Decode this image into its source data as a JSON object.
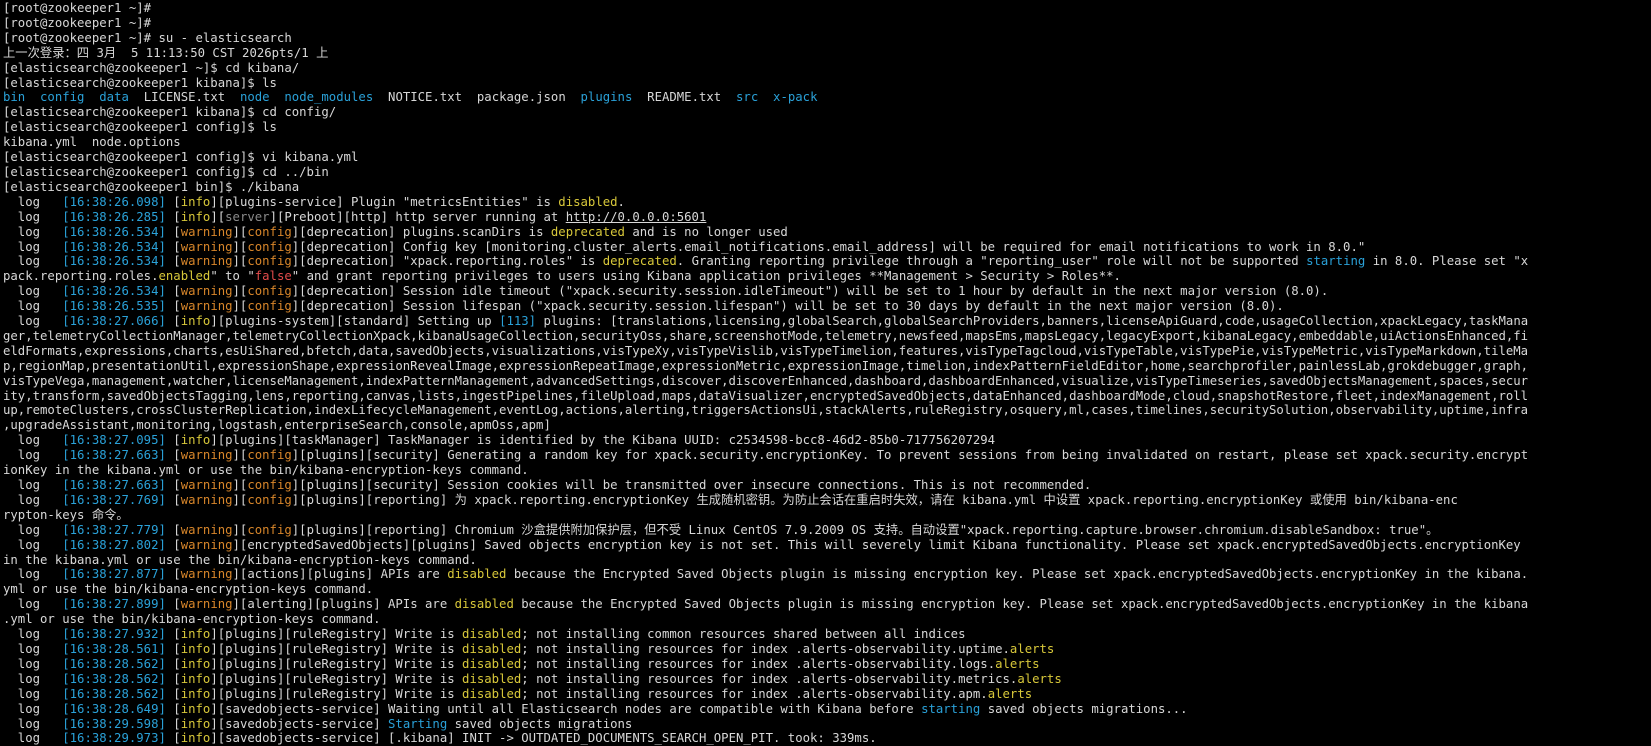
{
  "colors": {
    "background": "#000000",
    "text": "#d8d8d8",
    "blue": "#2aa1d8",
    "yellow": "#d8c83a",
    "orange": "#d8862a",
    "gray": "#8a8a8a",
    "red": "#e34b4b"
  },
  "lines": [
    [
      [
        "[root@zookeeper1 ~]#",
        ""
      ]
    ],
    [
      [
        "[root@zookeeper1 ~]#",
        ""
      ]
    ],
    [
      [
        "[root@zookeeper1 ~]# su - elasticsearch",
        ""
      ]
    ],
    [
      [
        "上一次登录：四 3月  5 11:13:50 CST 2026pts/1 上",
        ""
      ]
    ],
    [
      [
        "[elasticsearch@zookeeper1 ~]$ cd kibana/",
        ""
      ]
    ],
    [
      [
        "[elasticsearch@zookeeper1 kibana]$ ls",
        ""
      ]
    ],
    [
      [
        "bin",
        "c-blue"
      ],
      [
        "  ",
        ""
      ],
      [
        "config",
        "c-blue"
      ],
      [
        "  ",
        ""
      ],
      [
        "data",
        "c-blue"
      ],
      [
        "  LICENSE.txt  ",
        ""
      ],
      [
        "node",
        "c-blue"
      ],
      [
        "  ",
        ""
      ],
      [
        "node_modules",
        "c-blue"
      ],
      [
        "  NOTICE.txt  package.json  ",
        ""
      ],
      [
        "plugins",
        "c-blue"
      ],
      [
        "  README.txt  ",
        ""
      ],
      [
        "src",
        "c-blue"
      ],
      [
        "  ",
        ""
      ],
      [
        "x-pack",
        "c-blue"
      ]
    ],
    [
      [
        "[elasticsearch@zookeeper1 kibana]$ cd config/",
        ""
      ]
    ],
    [
      [
        "[elasticsearch@zookeeper1 config]$ ls",
        ""
      ]
    ],
    [
      [
        "kibana.yml  node.options",
        ""
      ]
    ],
    [
      [
        "[elasticsearch@zookeeper1 config]$ vi kibana.yml",
        ""
      ]
    ],
    [
      [
        "[elasticsearch@zookeeper1 config]$ cd ../bin",
        ""
      ]
    ],
    [
      [
        "[elasticsearch@zookeeper1 bin]$ ./kibana",
        ""
      ]
    ],
    [
      [
        "  log   ",
        ""
      ],
      [
        "[16:38:26.098]",
        "c-blue"
      ],
      [
        " [",
        ""
      ],
      [
        "info",
        "c-yellow"
      ],
      [
        "][plugins-service] Plugin \"metricsEntities\" is ",
        ""
      ],
      [
        "disabled",
        "c-yellow"
      ],
      [
        ".",
        ""
      ]
    ],
    [
      [
        "  log   ",
        ""
      ],
      [
        "[16:38:26.285]",
        "c-blue"
      ],
      [
        " [",
        ""
      ],
      [
        "info",
        "c-yellow"
      ],
      [
        "][",
        ""
      ],
      [
        "server",
        "c-gray"
      ],
      [
        "][Preboot][http] http server running at ",
        ""
      ],
      [
        "http://0.0.0.0:5601",
        "u"
      ]
    ],
    [
      [
        "  log   ",
        ""
      ],
      [
        "[16:38:26.534]",
        "c-blue"
      ],
      [
        " [",
        ""
      ],
      [
        "warning",
        "c-orange"
      ],
      [
        "][",
        ""
      ],
      [
        "config",
        "c-orange"
      ],
      [
        "][deprecation] plugins.scanDirs is ",
        ""
      ],
      [
        "deprecated",
        "c-yellow"
      ],
      [
        " and is no longer used",
        ""
      ]
    ],
    [
      [
        "  log   ",
        ""
      ],
      [
        "[16:38:26.534]",
        "c-blue"
      ],
      [
        " [",
        ""
      ],
      [
        "warning",
        "c-orange"
      ],
      [
        "][",
        ""
      ],
      [
        "config",
        "c-orange"
      ],
      [
        "][deprecation] Config key [monitoring.cluster_alerts.email_notifications.email_address] will be required for email notifications to work in 8.0.\"",
        ""
      ]
    ],
    [
      [
        "  log   ",
        ""
      ],
      [
        "[16:38:26.534]",
        "c-blue"
      ],
      [
        " [",
        ""
      ],
      [
        "warning",
        "c-orange"
      ],
      [
        "][",
        ""
      ],
      [
        "config",
        "c-orange"
      ],
      [
        "][deprecation] \"xpack.reporting.roles\" is ",
        ""
      ],
      [
        "deprecated",
        "c-yellow"
      ],
      [
        ". Granting reporting privilege through a \"reporting_user\" role will not be supported ",
        ""
      ],
      [
        "starting",
        "c-blue"
      ],
      [
        " in 8.0. Please set \"x",
        ""
      ]
    ],
    [
      [
        "pack.reporting.roles.",
        ""
      ],
      [
        "enabled",
        "c-yellow"
      ],
      [
        "\" to \"",
        ""
      ],
      [
        "false",
        "c-red"
      ],
      [
        "\" and grant reporting privileges to users using Kibana application privileges **Management > Security > Roles**.",
        ""
      ]
    ],
    [
      [
        "  log   ",
        ""
      ],
      [
        "[16:38:26.534]",
        "c-blue"
      ],
      [
        " [",
        ""
      ],
      [
        "warning",
        "c-orange"
      ],
      [
        "][",
        ""
      ],
      [
        "config",
        "c-orange"
      ],
      [
        "][deprecation] Session idle timeout (\"xpack.security.session.idleTimeout\") will be set to 1 hour by default in the next major version (8.0).",
        ""
      ]
    ],
    [
      [
        "  log   ",
        ""
      ],
      [
        "[16:38:26.535]",
        "c-blue"
      ],
      [
        " [",
        ""
      ],
      [
        "warning",
        "c-orange"
      ],
      [
        "][",
        ""
      ],
      [
        "config",
        "c-orange"
      ],
      [
        "][deprecation] Session lifespan (\"xpack.security.session.lifespan\") will be set to 30 days by default in the next major version (8.0).",
        ""
      ]
    ],
    [
      [
        "  log   ",
        ""
      ],
      [
        "[16:38:27.066]",
        "c-blue"
      ],
      [
        " [",
        ""
      ],
      [
        "info",
        "c-yellow"
      ],
      [
        "][plugins-system][standard] Setting up ",
        ""
      ],
      [
        "[113]",
        "c-blue"
      ],
      [
        " plugins: [translations,licensing,globalSearch,globalSearchProviders,banners,licenseApiGuard,code,usageCollection,xpackLegacy,taskMana",
        ""
      ]
    ],
    [
      [
        "ger,telemetryCollectionManager,telemetryCollectionXpack,kibanaUsageCollection,securityOss,share,screenshotMode,telemetry,newsfeed,mapsEms,mapsLegacy,legacyExport,kibanaLegacy,embeddable,uiActionsEnhanced,fi",
        ""
      ]
    ],
    [
      [
        "eldFormats,expressions,charts,esUiShared,bfetch,data,savedObjects,visualizations,visTypeXy,visTypeVislib,visTypeTimelion,features,visTypeTagcloud,visTypeTable,visTypePie,visTypeMetric,visTypeMarkdown,tileMa",
        ""
      ]
    ],
    [
      [
        "p,regionMap,presentationUtil,expressionShape,expressionRevealImage,expressionRepeatImage,expressionMetric,expressionImage,timelion,indexPatternFieldEditor,home,searchprofiler,painlessLab,grokdebugger,graph,",
        ""
      ]
    ],
    [
      [
        "visTypeVega,management,watcher,licenseManagement,indexPatternManagement,advancedSettings,discover,discoverEnhanced,dashboard,dashboardEnhanced,visualize,visTypeTimeseries,savedObjectsManagement,spaces,secur",
        ""
      ]
    ],
    [
      [
        "ity,transform,savedObjectsTagging,lens,reporting,canvas,lists,ingestPipelines,fileUpload,maps,dataVisualizer,encryptedSavedObjects,dataEnhanced,dashboardMode,cloud,snapshotRestore,fleet,indexManagement,roll",
        ""
      ]
    ],
    [
      [
        "up,remoteClusters,crossClusterReplication,indexLifecycleManagement,eventLog,actions,alerting,triggersActionsUi,stackAlerts,ruleRegistry,osquery,ml,cases,timelines,securitySolution,observability,uptime,infra",
        ""
      ]
    ],
    [
      [
        ",upgradeAssistant,monitoring,logstash,enterpriseSearch,console,apmOss,apm]",
        ""
      ]
    ],
    [
      [
        "  log   ",
        ""
      ],
      [
        "[16:38:27.095]",
        "c-blue"
      ],
      [
        " [",
        ""
      ],
      [
        "info",
        "c-yellow"
      ],
      [
        "][plugins][taskManager] TaskManager is identified by the Kibana UUID: c2534598-bcc8-46d2-85b0-717756207294",
        ""
      ]
    ],
    [
      [
        "  log   ",
        ""
      ],
      [
        "[16:38:27.663]",
        "c-blue"
      ],
      [
        " [",
        ""
      ],
      [
        "warning",
        "c-orange"
      ],
      [
        "][",
        ""
      ],
      [
        "config",
        "c-orange"
      ],
      [
        "][plugins][security] Generating a random key for xpack.security.encryptionKey. To prevent sessions from being invalidated on restart, please set xpack.security.encrypt",
        ""
      ]
    ],
    [
      [
        "ionKey in the kibana.yml or use the bin/kibana-encryption-keys command.",
        ""
      ]
    ],
    [
      [
        "  log   ",
        ""
      ],
      [
        "[16:38:27.663]",
        "c-blue"
      ],
      [
        " [",
        ""
      ],
      [
        "warning",
        "c-orange"
      ],
      [
        "][",
        ""
      ],
      [
        "config",
        "c-orange"
      ],
      [
        "][plugins][security] Session cookies will be transmitted over insecure connections. This is not recommended.",
        ""
      ]
    ],
    [
      [
        "  log   ",
        ""
      ],
      [
        "[16:38:27.769]",
        "c-blue"
      ],
      [
        " [",
        ""
      ],
      [
        "warning",
        "c-orange"
      ],
      [
        "][",
        ""
      ],
      [
        "config",
        "c-orange"
      ],
      [
        "][plugins][reporting] 为 xpack.reporting.encryptionKey 生成随机密钥。为防止会话在重启时失效，请在 kibana.yml 中设置 xpack.reporting.encryptionKey 或使用 bin/kibana-enc",
        ""
      ]
    ],
    [
      [
        "rypton-keys 命令。",
        ""
      ]
    ],
    [
      [
        "  log   ",
        ""
      ],
      [
        "[16:38:27.779]",
        "c-blue"
      ],
      [
        " [",
        ""
      ],
      [
        "warning",
        "c-orange"
      ],
      [
        "][",
        ""
      ],
      [
        "config",
        "c-orange"
      ],
      [
        "][plugins][reporting] Chromium 沙盒提供附加保护层，但不受 Linux CentOS 7.9.2009 OS 支持。自动设置\"xpack.reporting.capture.browser.chromium.disableSandbox: true\"。",
        ""
      ]
    ],
    [
      [
        "  log   ",
        ""
      ],
      [
        "[16:38:27.802]",
        "c-blue"
      ],
      [
        " [",
        ""
      ],
      [
        "warning",
        "c-orange"
      ],
      [
        "][encryptedSavedObjects][plugins] Saved objects encryption key is not set. This will severely limit Kibana functionality. Please set xpack.encryptedSavedObjects.encryptionKey",
        ""
      ]
    ],
    [
      [
        "in the kibana.yml or use the bin/kibana-encryption-keys command.",
        ""
      ]
    ],
    [
      [
        "  log   ",
        ""
      ],
      [
        "[16:38:27.877]",
        "c-blue"
      ],
      [
        " [",
        ""
      ],
      [
        "warning",
        "c-orange"
      ],
      [
        "][actions][plugins] APIs are ",
        ""
      ],
      [
        "disabled",
        "c-yellow"
      ],
      [
        " because the Encrypted Saved Objects plugin is missing encryption key. Please set xpack.encryptedSavedObjects.encryptionKey in the kibana.",
        ""
      ]
    ],
    [
      [
        "yml or use the bin/kibana-encryption-keys command.",
        ""
      ]
    ],
    [
      [
        "  log   ",
        ""
      ],
      [
        "[16:38:27.899]",
        "c-blue"
      ],
      [
        " [",
        ""
      ],
      [
        "warning",
        "c-orange"
      ],
      [
        "][alerting][plugins] APIs are ",
        ""
      ],
      [
        "disabled",
        "c-yellow"
      ],
      [
        " because the Encrypted Saved Objects plugin is missing encryption key. Please set xpack.encryptedSavedObjects.encryptionKey in the kibana",
        ""
      ]
    ],
    [
      [
        ".yml or use the bin/kibana-encryption-keys command.",
        ""
      ]
    ],
    [
      [
        "  log   ",
        ""
      ],
      [
        "[16:38:27.932]",
        "c-blue"
      ],
      [
        " [",
        ""
      ],
      [
        "info",
        "c-yellow"
      ],
      [
        "][plugins][ruleRegistry] Write is ",
        ""
      ],
      [
        "disabled",
        "c-yellow"
      ],
      [
        "; not installing common resources shared between all indices",
        ""
      ]
    ],
    [
      [
        "  log   ",
        ""
      ],
      [
        "[16:38:28.561]",
        "c-blue"
      ],
      [
        " [",
        ""
      ],
      [
        "info",
        "c-yellow"
      ],
      [
        "][plugins][ruleRegistry] Write is ",
        ""
      ],
      [
        "disabled",
        "c-yellow"
      ],
      [
        "; not installing resources for index .alerts-observability.uptime.",
        ""
      ],
      [
        "alerts",
        "c-yellow"
      ]
    ],
    [
      [
        "  log   ",
        ""
      ],
      [
        "[16:38:28.562]",
        "c-blue"
      ],
      [
        " [",
        ""
      ],
      [
        "info",
        "c-yellow"
      ],
      [
        "][plugins][ruleRegistry] Write is ",
        ""
      ],
      [
        "disabled",
        "c-yellow"
      ],
      [
        "; not installing resources for index .alerts-observability.logs.",
        ""
      ],
      [
        "alerts",
        "c-yellow"
      ]
    ],
    [
      [
        "  log   ",
        ""
      ],
      [
        "[16:38:28.562]",
        "c-blue"
      ],
      [
        " [",
        ""
      ],
      [
        "info",
        "c-yellow"
      ],
      [
        "][plugins][ruleRegistry] Write is ",
        ""
      ],
      [
        "disabled",
        "c-yellow"
      ],
      [
        "; not installing resources for index .alerts-observability.metrics.",
        ""
      ],
      [
        "alerts",
        "c-yellow"
      ]
    ],
    [
      [
        "  log   ",
        ""
      ],
      [
        "[16:38:28.562]",
        "c-blue"
      ],
      [
        " [",
        ""
      ],
      [
        "info",
        "c-yellow"
      ],
      [
        "][plugins][ruleRegistry] Write is ",
        ""
      ],
      [
        "disabled",
        "c-yellow"
      ],
      [
        "; not installing resources for index .alerts-observability.apm.",
        ""
      ],
      [
        "alerts",
        "c-yellow"
      ]
    ],
    [
      [
        "  log   ",
        ""
      ],
      [
        "[16:38:28.649]",
        "c-blue"
      ],
      [
        " [",
        ""
      ],
      [
        "info",
        "c-yellow"
      ],
      [
        "][savedobjects-service] Waiting until all Elasticsearch nodes are compatible with Kibana before ",
        ""
      ],
      [
        "starting",
        "c-blue"
      ],
      [
        " saved objects migrations...",
        ""
      ]
    ],
    [
      [
        "  log   ",
        ""
      ],
      [
        "[16:38:29.598]",
        "c-blue"
      ],
      [
        " [",
        ""
      ],
      [
        "info",
        "c-yellow"
      ],
      [
        "][savedobjects-service] ",
        ""
      ],
      [
        "Starting",
        "c-blue"
      ],
      [
        " saved objects migrations",
        ""
      ]
    ],
    [
      [
        "  log   ",
        ""
      ],
      [
        "[16:38:29.973]",
        "c-blue"
      ],
      [
        " [",
        ""
      ],
      [
        "info",
        "c-yellow"
      ],
      [
        "][savedobjects-service] [.kibana] INIT -> OUTDATED_DOCUMENTS_SEARCH_OPEN_PIT. took: 339ms.",
        ""
      ]
    ]
  ]
}
